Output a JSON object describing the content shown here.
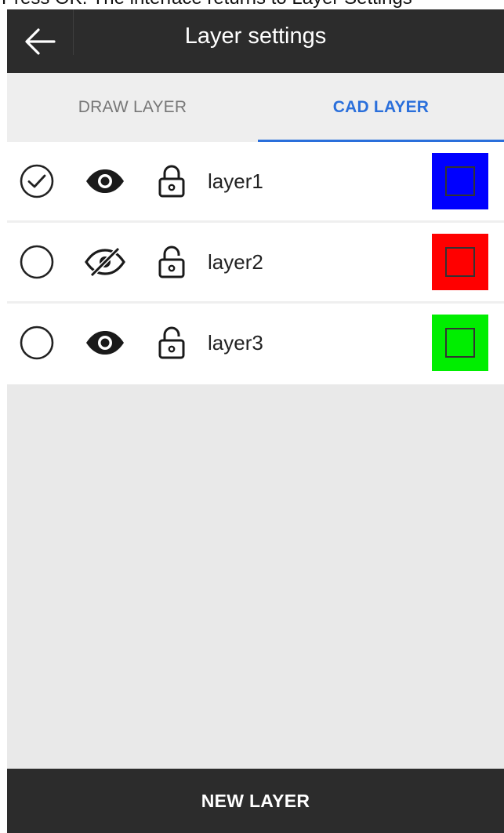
{
  "caption": "Press OK. The interface returns to Layer Settings",
  "appbar": {
    "title": "Layer settings",
    "back_icon": "arrow-left-icon"
  },
  "tabs": [
    {
      "label": "DRAW LAYER",
      "active": false
    },
    {
      "label": "CAD LAYER",
      "active": true
    }
  ],
  "colors": {
    "appbar_bg": "#2c2c2c",
    "accent": "#2a6fdb",
    "page_bg": "#e9e9e9"
  },
  "layers": [
    {
      "name": "layer1",
      "selected": true,
      "visible": true,
      "locked": true,
      "color": "#0000ff"
    },
    {
      "name": "layer2",
      "selected": false,
      "visible": false,
      "locked": false,
      "color": "#ff0000"
    },
    {
      "name": "layer3",
      "selected": false,
      "visible": true,
      "locked": false,
      "color": "#00ee00"
    }
  ],
  "footer": {
    "new_layer_label": "NEW LAYER"
  }
}
